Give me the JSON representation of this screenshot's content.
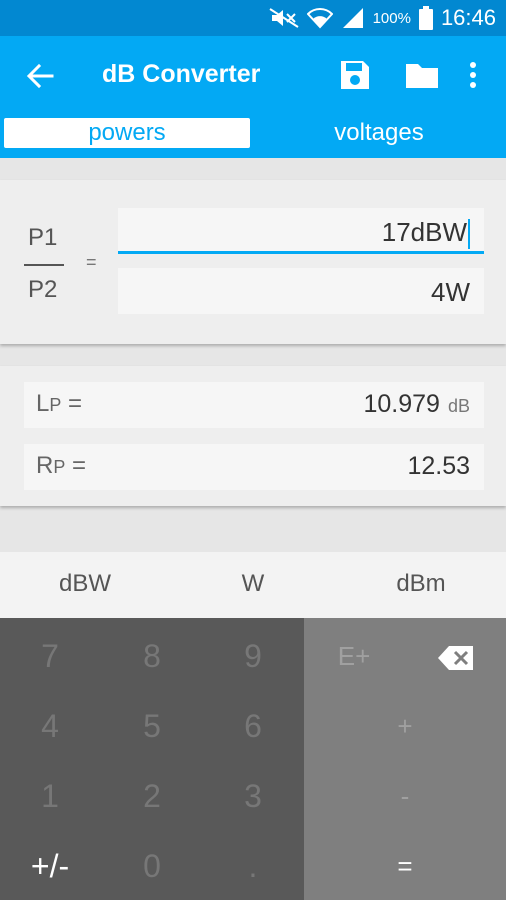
{
  "status": {
    "battery_pct": "100%",
    "time": "16:46"
  },
  "app": {
    "title": "dB Converter"
  },
  "tabs": [
    {
      "label": "powers"
    },
    {
      "label": "voltages"
    }
  ],
  "ratio": {
    "p1_label": "P1",
    "p2_label": "P2",
    "equals": "=",
    "p1_value": "17dBW",
    "p2_value": "4W"
  },
  "results": {
    "lp": {
      "label_main": "L",
      "label_sub": "P",
      "suffix": " =",
      "value": "10.979",
      "unit": "dB"
    },
    "rp": {
      "label_main": "R",
      "label_sub": "P",
      "suffix": " =",
      "value": "12.53"
    }
  },
  "units": [
    "dBW",
    "W",
    "dBm"
  ],
  "keypad": {
    "keys": [
      "7",
      "8",
      "9",
      "4",
      "5",
      "6",
      "1",
      "2",
      "3",
      "+/-",
      "0",
      "."
    ],
    "ops": {
      "eplus": "E+",
      "plus": "+",
      "minus": "-",
      "equals": "="
    }
  },
  "icons": {
    "back": "arrow-back-icon",
    "save": "save-icon",
    "folder": "folder-icon",
    "more": "more-vert-icon",
    "backspace": "backspace-icon"
  },
  "colors": {
    "primary": "#03a9f4",
    "status_bar": "#0288d1"
  }
}
